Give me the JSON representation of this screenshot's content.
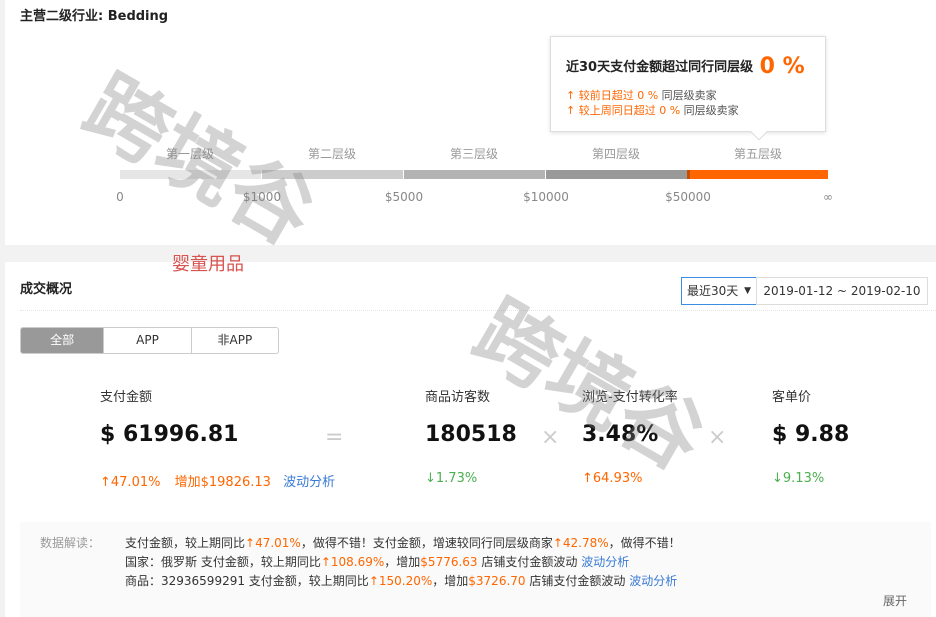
{
  "industry": {
    "title": "主营二级行业: Bedding"
  },
  "tiers": {
    "labels": [
      "第一层级",
      "第二层级",
      "第三层级",
      "第四层级",
      "第五层级"
    ],
    "ticks": [
      "0",
      "$1000",
      "$5000",
      "$10000",
      "$50000",
      "∞"
    ],
    "colors": [
      "#e6e6e6",
      "#cccccc",
      "#b3b3b3",
      "#999999",
      "#ff6600"
    ],
    "active_index": 4
  },
  "tooltip": {
    "title": "近30天支付金额超过同行同层级",
    "percent": "0 %",
    "line1_prefix": "↑ 较前日超过 ",
    "line1_value": "0 %",
    "line1_suffix": " 同层级卖家",
    "line2_prefix": "↑ 较上周同日超过 ",
    "line2_value": "0 %",
    "line2_suffix": " 同层级卖家"
  },
  "watermark": {
    "category": "婴童用品",
    "text": "跨境谷"
  },
  "overview": {
    "title": "成交概况",
    "period": "最近30天",
    "date_range": "2019-01-12 ~ 2019-02-10",
    "tabs": [
      "全部",
      "APP",
      "非APP"
    ],
    "active_tab": 0
  },
  "metrics": {
    "pay": {
      "label": "支付金额",
      "value": "$ 61996.81",
      "change": "↑47.01%",
      "increase": "增加$19826.13",
      "link": "波动分析"
    },
    "visitors": {
      "label": "商品访客数",
      "value": "180518",
      "change": "↓1.73%"
    },
    "conversion": {
      "label": "浏览-支付转化率",
      "value": "3.48%",
      "change": "↑64.93%"
    },
    "aov": {
      "label": "客单价",
      "value": "$ 9.88",
      "change": "↓9.13%"
    },
    "op_equals": "=",
    "op_times": "×"
  },
  "insight": {
    "label": "数据解读：",
    "line1": {
      "a": "支付金额，较上期同比",
      "b": "↑47.01%",
      "c": "，做得不错！支付金额，增速较同行同层级商家",
      "d": "↑42.78%",
      "e": "，做得不错！"
    },
    "line2": {
      "a": "国家：俄罗斯    支付金额，较上期同比",
      "b": "↑108.69%",
      "c": "，增加",
      "d": "$5776.63",
      "e": " 店铺支付金额波动  ",
      "link": "波动分析"
    },
    "line3": {
      "a": "商品：32936599291    支付金额，较上期同比",
      "b": "↑150.20%",
      "c": "，增加",
      "d": "$3726.70",
      "e": " 店铺支付金额波动  ",
      "link": "波动分析"
    },
    "expand": "展开"
  }
}
